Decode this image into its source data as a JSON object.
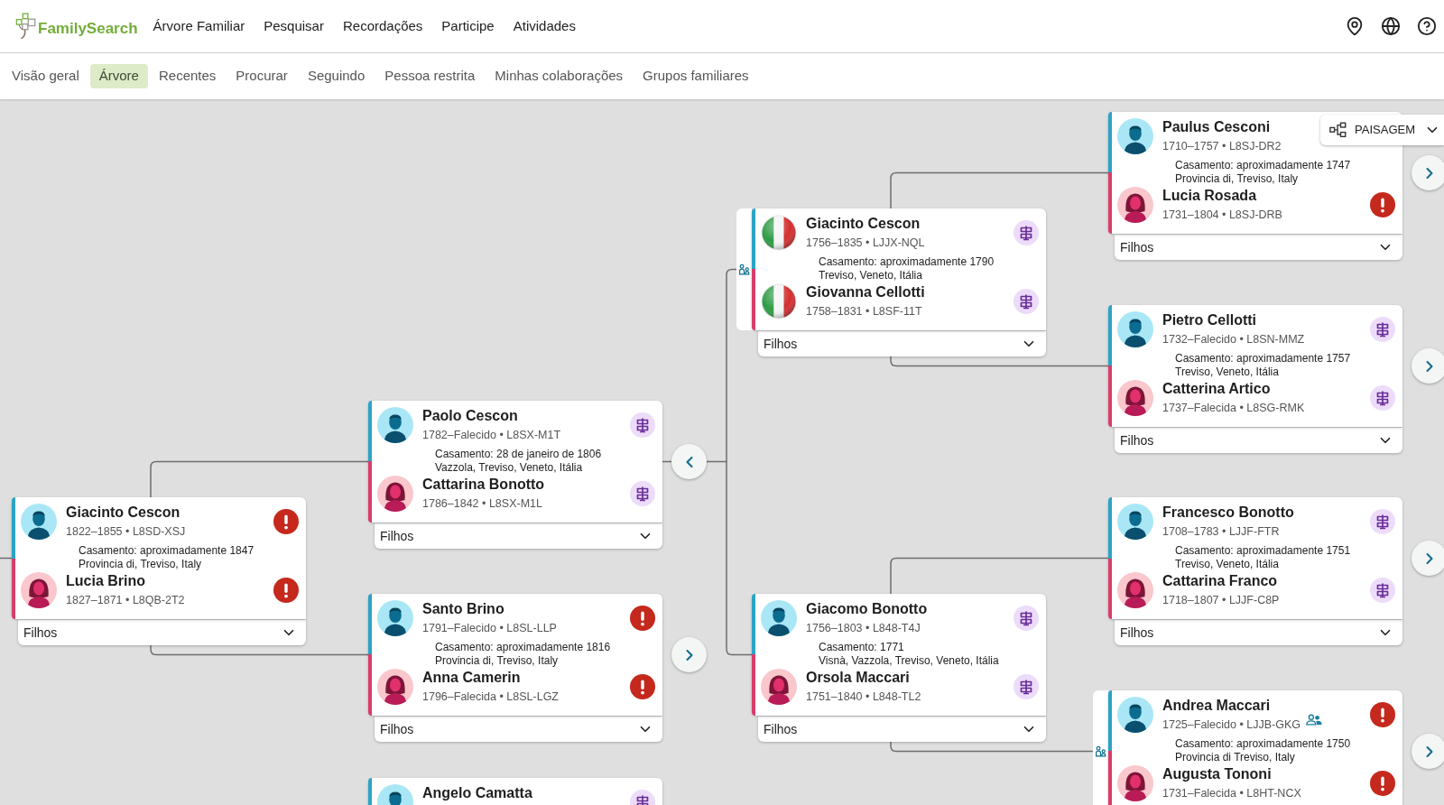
{
  "header": {
    "logo": "FamilySearch",
    "nav": [
      "Árvore Familiar",
      "Pesquisar",
      "Recordações",
      "Participe",
      "Atividades"
    ]
  },
  "subnav": [
    {
      "label": "Visão geral",
      "selected": false
    },
    {
      "label": "Árvore",
      "selected": true
    },
    {
      "label": "Recentes",
      "selected": false
    },
    {
      "label": "Procurar",
      "selected": false
    },
    {
      "label": "Seguindo",
      "selected": false
    },
    {
      "label": "Pessoa restrita",
      "selected": false
    },
    {
      "label": "Minhas colaborações",
      "selected": false
    },
    {
      "label": "Grupos familiares",
      "selected": false
    }
  ],
  "layout_button": {
    "label": "PAISAGEM"
  },
  "cards": [
    {
      "husband": {
        "name": "Giacinto Cescon",
        "details": "1822–1855 • L8SD-XSJ",
        "avatar": {
          "kind": "man"
        },
        "hint": {
          "kind": "warning"
        }
      },
      "marriage": {
        "date": "Casamento: aproximadamente 1847",
        "place": "Provincia di, Treviso, Italy"
      },
      "wife": {
        "name": "Lucia Brino",
        "details": "1827–1871 • L8QB-2T2",
        "avatar": {
          "kind": "woman"
        },
        "hint": {
          "kind": "warning"
        }
      },
      "children_label": "Filhos"
    },
    {
      "husband": {
        "name": "Paolo Cescon",
        "details": "1782–Falecido • L8SX-M1T",
        "avatar": {
          "kind": "man"
        },
        "hint": {
          "kind": "research"
        }
      },
      "marriage": {
        "date": "Casamento: 28 de janeiro de 1806",
        "place": "Vazzola, Treviso, Veneto, Itália"
      },
      "wife": {
        "name": "Cattarina Bonotto",
        "details": "1786–1842 • L8SX-M1L",
        "avatar": {
          "kind": "woman"
        },
        "hint": {
          "kind": "research"
        }
      },
      "children_label": "Filhos",
      "parents_toggle": {
        "kind": "collapse"
      }
    },
    {
      "husband": {
        "name": "Santo Brino",
        "details": "1791–Falecido • L8SL-LLP",
        "avatar": {
          "kind": "man"
        },
        "hint": {
          "kind": "warning"
        }
      },
      "marriage": {
        "date": "Casamento: aproximadamente 1816",
        "place": "Provincia di, Treviso, Italy"
      },
      "wife": {
        "name": "Anna Camerin",
        "details": "1796–Falecida • L8SL-LGZ",
        "avatar": {
          "kind": "woman"
        },
        "hint": {
          "kind": "warning"
        }
      },
      "children_label": "Filhos",
      "parents_toggle": {
        "kind": "expand"
      }
    },
    {
      "husband": {
        "name": "Angelo Camatta",
        "avatar": {
          "kind": "man"
        },
        "hint": {
          "kind": "research"
        }
      }
    },
    {
      "husband": {
        "name": "Giacinto Cescon",
        "details": "1756–1835 • LJJX-NQL",
        "avatar": {
          "kind": "flag"
        },
        "hint": {
          "kind": "research"
        }
      },
      "marriage": {
        "date": "Casamento: aproximadamente 1790",
        "place": "Treviso, Veneto, Itália"
      },
      "wife": {
        "name": "Giovanna Cellotti",
        "details": "1758–1831 • L8SF-11T",
        "avatar": {
          "kind": "flag"
        },
        "hint": {
          "kind": "research"
        }
      },
      "children_label": "Filhos",
      "side_tab": true
    },
    {
      "husband": {
        "name": "Giacomo Bonotto",
        "details": "1756–1803 • L848-T4J",
        "avatar": {
          "kind": "man"
        },
        "hint": {
          "kind": "research"
        }
      },
      "marriage": {
        "date": "Casamento: 1771",
        "place": "Visnà, Vazzola, Treviso, Veneto, Itália"
      },
      "wife": {
        "name": "Orsola Maccari",
        "details": "1751–1840 • L848-TL2",
        "avatar": {
          "kind": "woman"
        },
        "hint": {
          "kind": "research"
        }
      },
      "children_label": "Filhos"
    },
    {
      "husband": {
        "name": "Paulus Cesconi",
        "details": "1710–1757 • L8SJ-DR2",
        "avatar": {
          "kind": "man"
        }
      },
      "marriage": {
        "date": "Casamento: aproximadamente 1747",
        "place": "Provincia di, Treviso, Italy"
      },
      "wife": {
        "name": "Lucia Rosada",
        "details": "1731–1804 • L8SJ-DRB",
        "avatar": {
          "kind": "woman"
        },
        "hint": {
          "kind": "warning"
        }
      },
      "children_label": "Filhos",
      "parents_toggle": {
        "kind": "expand"
      }
    },
    {
      "husband": {
        "name": "Pietro Cellotti",
        "details": "1732–Falecido • L8SN-MMZ",
        "avatar": {
          "kind": "man"
        },
        "hint": {
          "kind": "research"
        }
      },
      "marriage": {
        "date": "Casamento: aproximadamente 1757",
        "place": "Treviso, Veneto, Itália"
      },
      "wife": {
        "name": "Catterina Artico",
        "details": "1737–Falecida • L8SG-RMK",
        "avatar": {
          "kind": "woman"
        },
        "hint": {
          "kind": "research"
        }
      },
      "children_label": "Filhos",
      "parents_toggle": {
        "kind": "expand"
      }
    },
    {
      "husband": {
        "name": "Francesco Bonotto",
        "details": "1708–1783 • LJJF-FTR",
        "avatar": {
          "kind": "man"
        },
        "hint": {
          "kind": "research"
        }
      },
      "marriage": {
        "date": "Casamento: aproximadamente 1751",
        "place": "Treviso, Veneto, Itália"
      },
      "wife": {
        "name": "Cattarina Franco",
        "details": "1718–1807 • LJJF-C8P",
        "avatar": {
          "kind": "woman"
        },
        "hint": {
          "kind": "research"
        }
      },
      "children_label": "Filhos",
      "parents_toggle": {
        "kind": "expand"
      }
    },
    {
      "husband": {
        "name": "Andrea Maccari",
        "details": "1725–Falecido • LJJB-GKG",
        "avatar": {
          "kind": "man"
        },
        "hint": {
          "kind": "warning"
        },
        "shared": true
      },
      "marriage": {
        "date": "Casamento: aproximadamente 1750",
        "place": "Provincia di Treviso, Italy"
      },
      "wife": {
        "name": "Augusta Tononi",
        "details": "1731–Falecida • L8HT-NCX",
        "avatar": {
          "kind": "woman"
        },
        "hint": {
          "kind": "warning"
        }
      },
      "side_tab": true,
      "parents_toggle": {
        "kind": "expand"
      }
    }
  ]
}
